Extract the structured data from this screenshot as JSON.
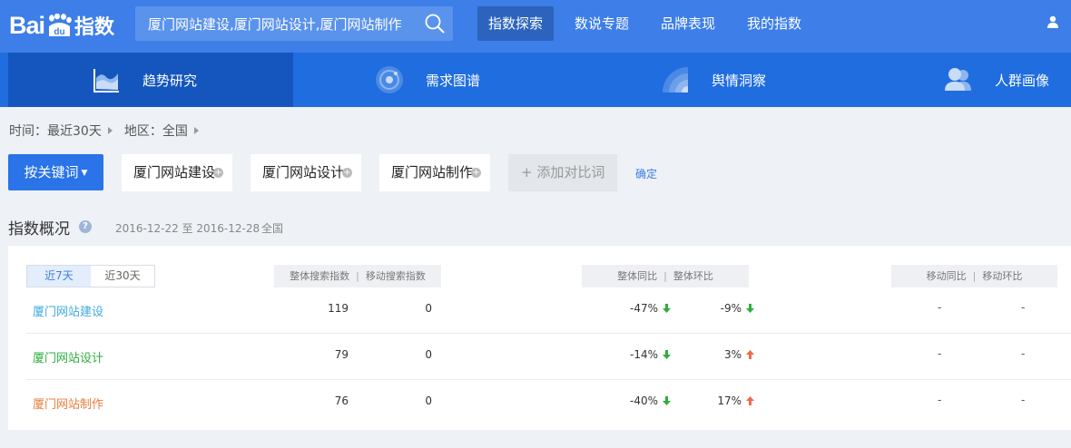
{
  "header": {
    "logo_text": "Bai",
    "logo_du": "du",
    "logo_suffix": "指数",
    "search_value": "厦门网站建设,厦门网站设计,厦门网站制作",
    "nav": [
      {
        "label": "指数探索",
        "active": true
      },
      {
        "label": "数说专题",
        "active": false
      },
      {
        "label": "品牌表现",
        "active": false
      },
      {
        "label": "我的指数",
        "active": false
      }
    ]
  },
  "subnav": {
    "tabs": [
      {
        "label": "趋势研究",
        "icon": "trend-chart-icon",
        "active": true
      },
      {
        "label": "需求图谱",
        "icon": "demand-map-icon",
        "active": false
      },
      {
        "label": "舆情洞察",
        "icon": "sentiment-icon",
        "active": false
      },
      {
        "label": "人群画像",
        "icon": "crowd-portrait-icon",
        "active": false
      }
    ]
  },
  "filters": {
    "time": "时间：最近30天",
    "region": "地区：全国"
  },
  "keywords": {
    "mode_button": "按关键词",
    "items": [
      "厦门网站建设",
      "厦门网站设计",
      "厦门网站制作"
    ],
    "add_compare": "添加对比词",
    "confirm": "确定"
  },
  "overview": {
    "title": "指数概况",
    "date_range": "2016-12-22 至 2016-12-28",
    "region": "全国",
    "range_options": [
      "近7天",
      "近30天"
    ],
    "active_range": "近7天",
    "headers": {
      "overall_search": "整体搜索指数",
      "mobile_search": "移动搜索指数",
      "overall_yoy": "整体同比",
      "overall_mom": "整体环比",
      "mobile_yoy": "移动同比",
      "mobile_mom": "移动环比"
    },
    "rows": [
      {
        "keyword": "厦门网站建设",
        "color": "#41a9e0",
        "overall": "119",
        "mobile": "0",
        "overall_yoy": "-47%",
        "yoy_dir": "down",
        "overall_mom": "-9%",
        "mom_dir": "down",
        "mobile_yoy": "-",
        "mobile_mom": "-"
      },
      {
        "keyword": "厦门网站设计",
        "color": "#2eae3c",
        "overall": "79",
        "mobile": "0",
        "overall_yoy": "-14%",
        "yoy_dir": "down",
        "overall_mom": "3%",
        "mom_dir": "up",
        "mobile_yoy": "-",
        "mobile_mom": "-"
      },
      {
        "keyword": "厦门网站制作",
        "color": "#e77e3c",
        "overall": "76",
        "mobile": "0",
        "overall_yoy": "-40%",
        "yoy_dir": "down",
        "overall_mom": "17%",
        "mom_dir": "up",
        "mobile_yoy": "-",
        "mobile_mom": "-"
      }
    ]
  },
  "colors": {
    "topbar": "#3d7ee8",
    "subnav": "#1f6ddf",
    "up_arrow": "#ef6a49",
    "down_arrow": "#2eae3c"
  }
}
